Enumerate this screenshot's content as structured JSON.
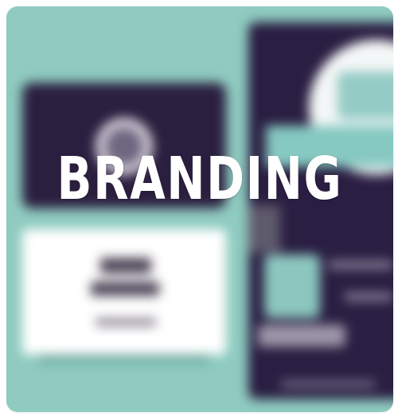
{
  "tile": {
    "title": "BRANDING",
    "background_color": "#8fcbc0",
    "title_color": "#ffffff"
  }
}
